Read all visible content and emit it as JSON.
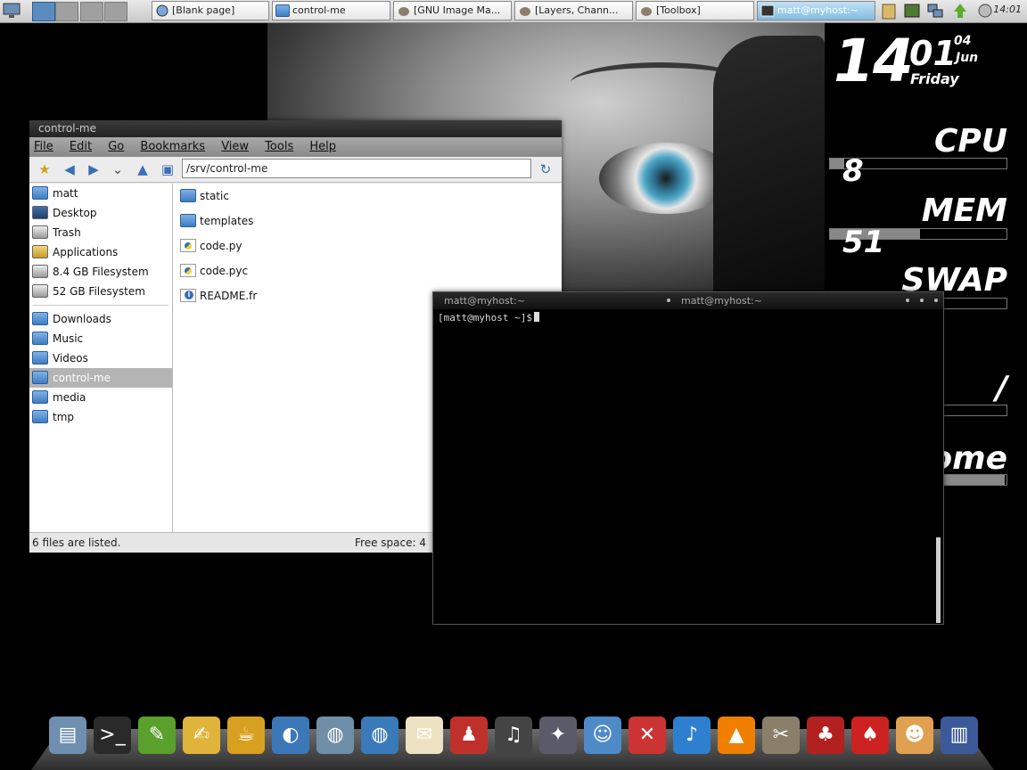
{
  "top_panel": {
    "tasks": [
      {
        "label": "[Blank page]"
      },
      {
        "label": "control-me"
      },
      {
        "label": "[GNU Image Ma..."
      },
      {
        "label": "[Layers, Chann..."
      },
      {
        "label": "[Toolbox]"
      },
      {
        "label": "matt@myhost:~"
      }
    ],
    "clock": "14:01"
  },
  "conky": {
    "hour": "14",
    "minute": "01",
    "day": "04",
    "month": "Jun",
    "weekday": "Friday",
    "cpu_label": "CPU",
    "cpu_value": "8",
    "cpu_percent": 8,
    "mem_label": "MEM",
    "mem_value": "51",
    "mem_percent": 51,
    "swap_label": "SWAP",
    "swap_percent": 0,
    "root_label": "/",
    "root_percent": 0,
    "home_label": "home",
    "home_percent": 99
  },
  "file_manager": {
    "title": "control-me",
    "menu": [
      "File",
      "Edit",
      "Go",
      "Bookmarks",
      "View",
      "Tools",
      "Help"
    ],
    "address": "/srv/control-me",
    "sidebar_group1": [
      "matt",
      "Desktop",
      "Trash",
      "Applications",
      "8.4 GB Filesystem",
      "52 GB Filesystem"
    ],
    "sidebar_group2": [
      "Downloads",
      "Music",
      "Videos",
      "control-me",
      "media",
      "tmp"
    ],
    "files": [
      "static",
      "templates",
      "code.py",
      "code.pyc",
      "README.fr"
    ],
    "status_left": "6 files are listed.",
    "status_right": "Free space: 4"
  },
  "terminal": {
    "title_left": "matt@myhost:~",
    "title_center": "matt@myhost:~",
    "prompt": "[matt@myhost ~]$"
  },
  "colors": {
    "accent": "#3f7dc2",
    "panel": "#d9d9d9",
    "terminal_bg": "#000000"
  },
  "dock_icons": [
    "file-manager-icon",
    "terminal-icon",
    "text-editor-icon",
    "notes-icon",
    "teapot-icon",
    "browser-icon",
    "network-globe-icon",
    "earth-icon",
    "mail-icon",
    "joystick-icon",
    "music-player-icon",
    "pinwheel-icon",
    "chat-icon",
    "close-x-icon",
    "itunes-icon",
    "vlc-icon",
    "gimp-icon",
    "santa-icon",
    "poker-icon",
    "character-icon",
    "chart-icon"
  ]
}
